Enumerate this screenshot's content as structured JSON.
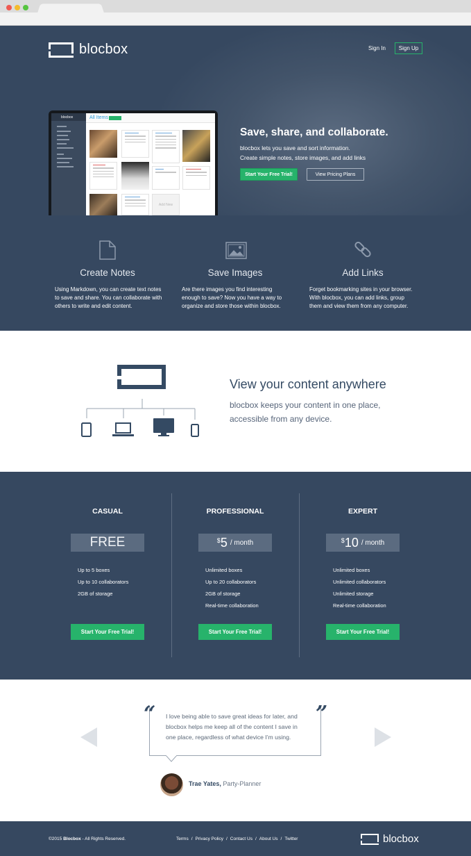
{
  "header": {
    "brand": "blocbox",
    "sign_in": "Sign In",
    "sign_up": "Sign Up"
  },
  "hero": {
    "headline": "Save, share, and collaborate.",
    "line1": "blocbox lets you save and sort information.",
    "line2": "Create simple notes, store images, and add links",
    "cta": "Start Your Free Trial!",
    "secondary": "View Pricing Plans",
    "screen_title": "All Items",
    "screen_brand": "blocbox",
    "add_new": "Add New"
  },
  "features": [
    {
      "title": "Create Notes",
      "icon": "document-icon",
      "lines": [
        "Using Markdown, you can create text notes",
        "to save and share. You can collaborate with",
        "others to write and edit content."
      ]
    },
    {
      "title": "Save Images",
      "icon": "image-icon",
      "lines": [
        "Are there images you find interesting",
        "enough to save? Now you have a way to",
        "organize and store those within blocbox."
      ]
    },
    {
      "title": "Add Links",
      "icon": "link-icon",
      "lines": [
        "Forget bookmarking sites in your browser.",
        "With blocbox, you can add links, group",
        "them and view them from any computer."
      ]
    }
  ],
  "anywhere": {
    "title": "View your content anywhere",
    "line1": "blocbox keeps your content in one place,",
    "line2": "accessible from any device."
  },
  "plans": [
    {
      "name": "CASUAL",
      "price_main": "FREE",
      "price_super": "",
      "price_suffix": "",
      "features": [
        "Up to 5 boxes",
        "Up to 10 collaborators",
        "2GB of storage"
      ],
      "cta": "Start Your Free Trial!"
    },
    {
      "name": "PROFESSIONAL",
      "price_main": "5",
      "price_super": "$",
      "price_suffix": "/ month",
      "features": [
        "Unlimited boxes",
        "Up to 20 collaborators",
        "2GB of storage",
        "Real-time collaboration"
      ],
      "cta": "Start Your Free Trial!"
    },
    {
      "name": "EXPERT",
      "price_main": "10",
      "price_super": "$",
      "price_suffix": "/ month",
      "features": [
        "Unlimited boxes",
        "Unlimited collaborators",
        "Unlimited storage",
        "Real-time collaboration"
      ],
      "cta": "Start Your Free Trial!"
    }
  ],
  "testimonial": {
    "lines": [
      "I love being able to save great ideas for later, and",
      "blocbox helps me keep all of the content I save in",
      "one place, regardless of what device I'm using."
    ],
    "open_quote": "“",
    "close_quote": "”",
    "name": "Trae Yates,",
    "role": " Party-Planner"
  },
  "footer": {
    "copy_prefix": "©2015 ",
    "copy_brand": "Blocbox",
    "copy_suffix": " - All Rights Reserved.",
    "links": [
      "Terms",
      "/",
      "Privacy Policy",
      "/",
      "Contact Us",
      "/",
      "About Us",
      "/",
      "Twitter"
    ],
    "brand": "blocbox"
  },
  "colors": {
    "navy": "#364860",
    "green": "#27b36b",
    "text_dark": "#344a63"
  }
}
